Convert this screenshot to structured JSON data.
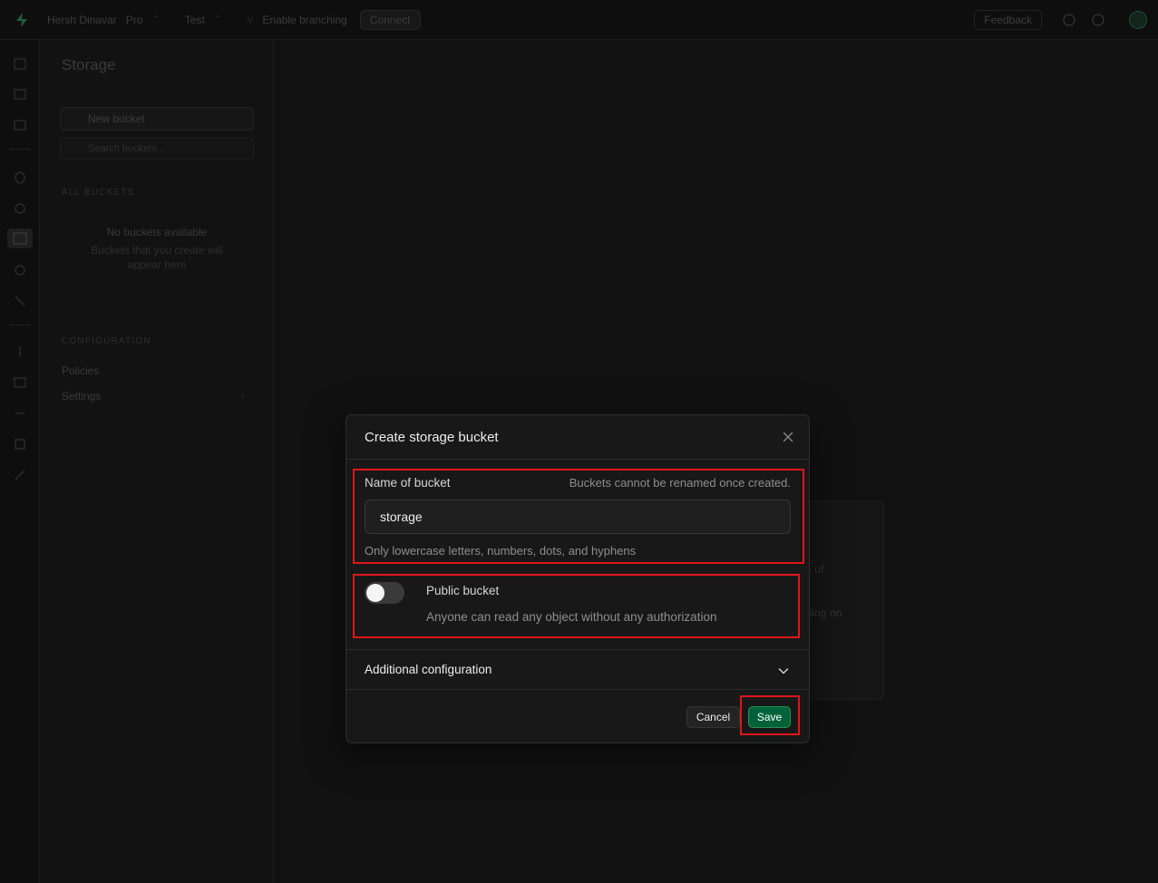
{
  "topbar": {
    "org_name": "Hersh Dinavar",
    "org_plan": "Pro",
    "project_name": "Test",
    "branch_label": "Enable branching",
    "connect_label": "Connect",
    "feedback_label": "Feedback"
  },
  "sidebar": {
    "title": "Storage",
    "new_bucket_label": "New bucket",
    "search_placeholder": "Search buckets...",
    "all_buckets_heading": "ALL BUCKETS",
    "empty_title": "No buckets available",
    "empty_desc": "Buckets that you create will appear here",
    "configuration_heading": "CONFIGURATION",
    "policies_label": "Policies",
    "settings_label": "Settings"
  },
  "background_card": {
    "line1": "s of",
    "line2": "ding on"
  },
  "modal": {
    "title": "Create storage bucket",
    "name_label": "Name of bucket",
    "name_note": "Buckets cannot be renamed once created.",
    "name_value": "storage",
    "name_help": "Only lowercase letters, numbers, dots, and hyphens",
    "public_label": "Public bucket",
    "public_desc": "Anyone can read any object without any authorization",
    "public_enabled": false,
    "additional_config_label": "Additional configuration",
    "cancel_label": "Cancel",
    "save_label": "Save"
  },
  "colors": {
    "accent": "#006239",
    "highlight": "#e0151b",
    "background": "#111111",
    "modal_bg": "#181818"
  }
}
